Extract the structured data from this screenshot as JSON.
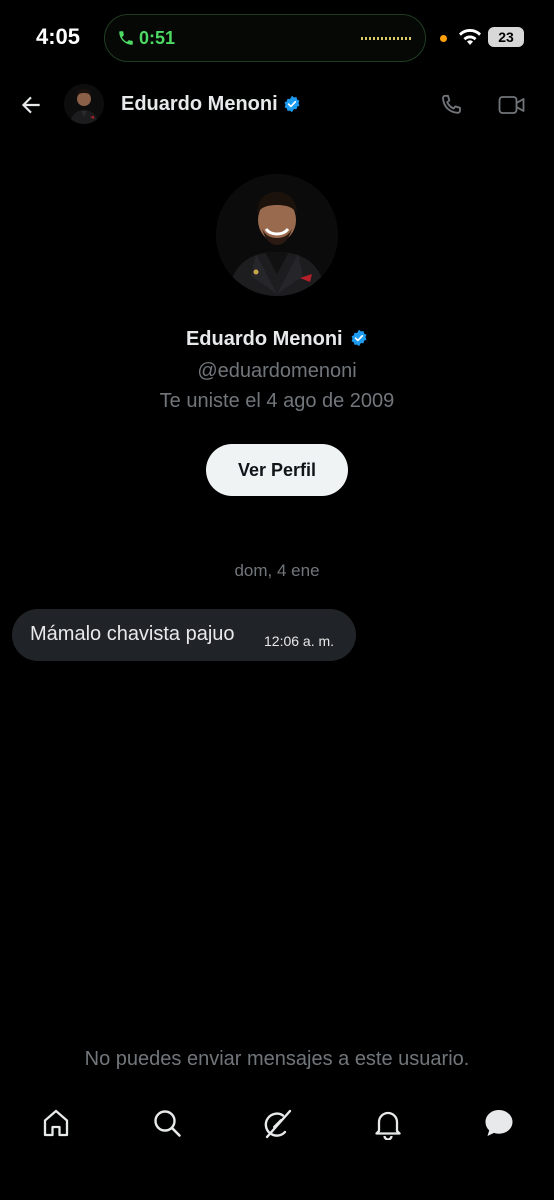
{
  "status_bar": {
    "time": "4:05",
    "call_duration": "0:51",
    "battery": "23"
  },
  "header": {
    "name": "Eduardo Menoni"
  },
  "profile": {
    "name": "Eduardo Menoni",
    "handle": "@eduardomenoni",
    "joined": "Te uniste el 4 ago de 2009",
    "view_profile_label": "Ver Perfil"
  },
  "conversation": {
    "date_separator": "dom, 4 ene",
    "messages": [
      {
        "text": "Mámalo chavista pajuo",
        "time": "12:06 a. m."
      }
    ]
  },
  "footer_notice": "No puedes enviar mensajes a este usuario.",
  "icons": [
    "back-arrow-icon",
    "verified-badge-icon",
    "phone-icon",
    "video-icon",
    "home-icon",
    "search-icon",
    "grok-icon",
    "bell-icon",
    "messages-icon"
  ],
  "colors": {
    "background": "#000000",
    "verified": "#1d9bf0",
    "call_green": "#4cd964",
    "bubble": "#202327"
  }
}
